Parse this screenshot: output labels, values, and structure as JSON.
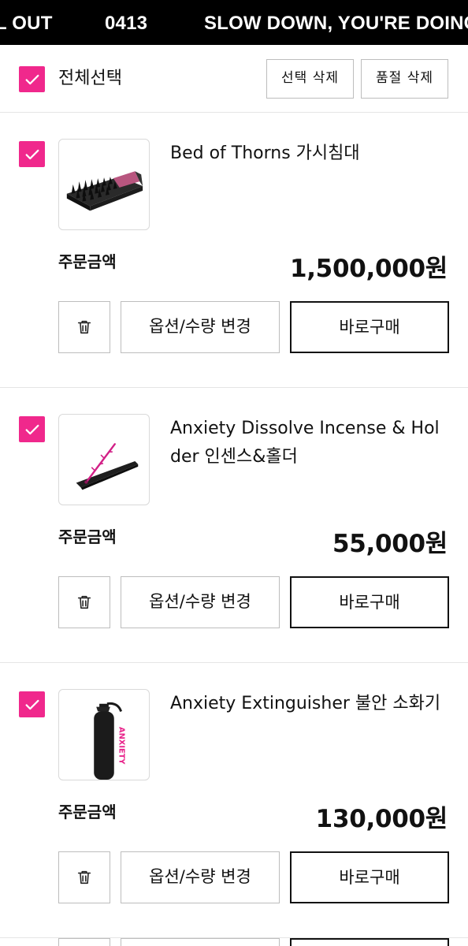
{
  "marquee": {
    "part1": "L OUT",
    "part2": "0413",
    "part3": "SLOW DOWN, YOU'RE DOING"
  },
  "select_bar": {
    "select_all_label": "전체선택",
    "delete_selected_label": "선택 삭제",
    "delete_soldout_label": "품절 삭제"
  },
  "items": [
    {
      "name": "Bed of Thorns 가시침대",
      "amount_label": "주문금액",
      "price": "1,500,000원",
      "option_label": "옵션/수량 변경",
      "buy_label": "바로구매",
      "checked": true
    },
    {
      "name": "Anxiety Dissolve Incense & Holder 인센스&홀더",
      "amount_label": "주문금액",
      "price": "55,000원",
      "option_label": "옵션/수량 변경",
      "buy_label": "바로구매",
      "checked": true
    },
    {
      "name": "Anxiety Extinguisher 불안 소화기",
      "amount_label": "주문금액",
      "price": "130,000원",
      "option_label": "옵션/수량 변경",
      "buy_label": "바로구매",
      "checked": true
    }
  ],
  "thumb_text": "ANXIETY",
  "colors": {
    "accent": "#f0288c",
    "banner_bg": "#000000",
    "border": "#bdbdbd"
  },
  "icons": {
    "checkbox": "check-icon",
    "delete": "trash-icon"
  }
}
